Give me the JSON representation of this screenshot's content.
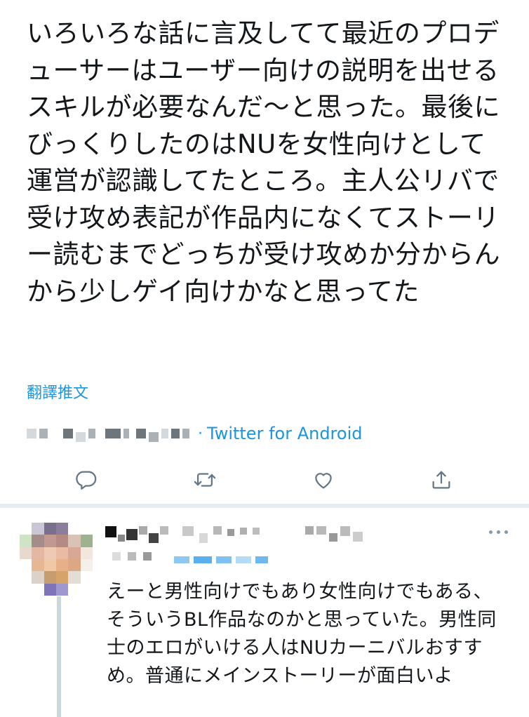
{
  "tweet": {
    "text": "いろいろな話に言及してて最近のプロデューサーはユーザー向けの説明を出せるスキルが必要なんだ〜と思った。最後にびっくりしたのはNUを女性向けとして運営が認識してたところ。主人公リバで受け攻め表記が作品内になくてストーリー読むまでどっちが受け攻めか分からんから少しゲイ向けかなと思ってた",
    "translate_label": "翻譯推文",
    "source_separator": "·",
    "source_client": "Twitter for Android"
  },
  "actions": {
    "reply_icon": "reply-icon",
    "retweet_icon": "retweet-icon",
    "like_icon": "like-icon",
    "share_icon": "share-icon",
    "icon_color": "#657786"
  },
  "reply": {
    "text": "えーと男性向けでもあり女性向けでもある、そういうBL作品なのかと思っていた。男性同士のエロがいける人はNUカーニバルおすすめ。普通にメインストーリーが面白いよ",
    "more_icon": "more-icon"
  },
  "colors": {
    "link": "#1b95e0",
    "text": "#14171a",
    "divider": "#e6ecf0",
    "thread_line": "#ccd6dd"
  }
}
